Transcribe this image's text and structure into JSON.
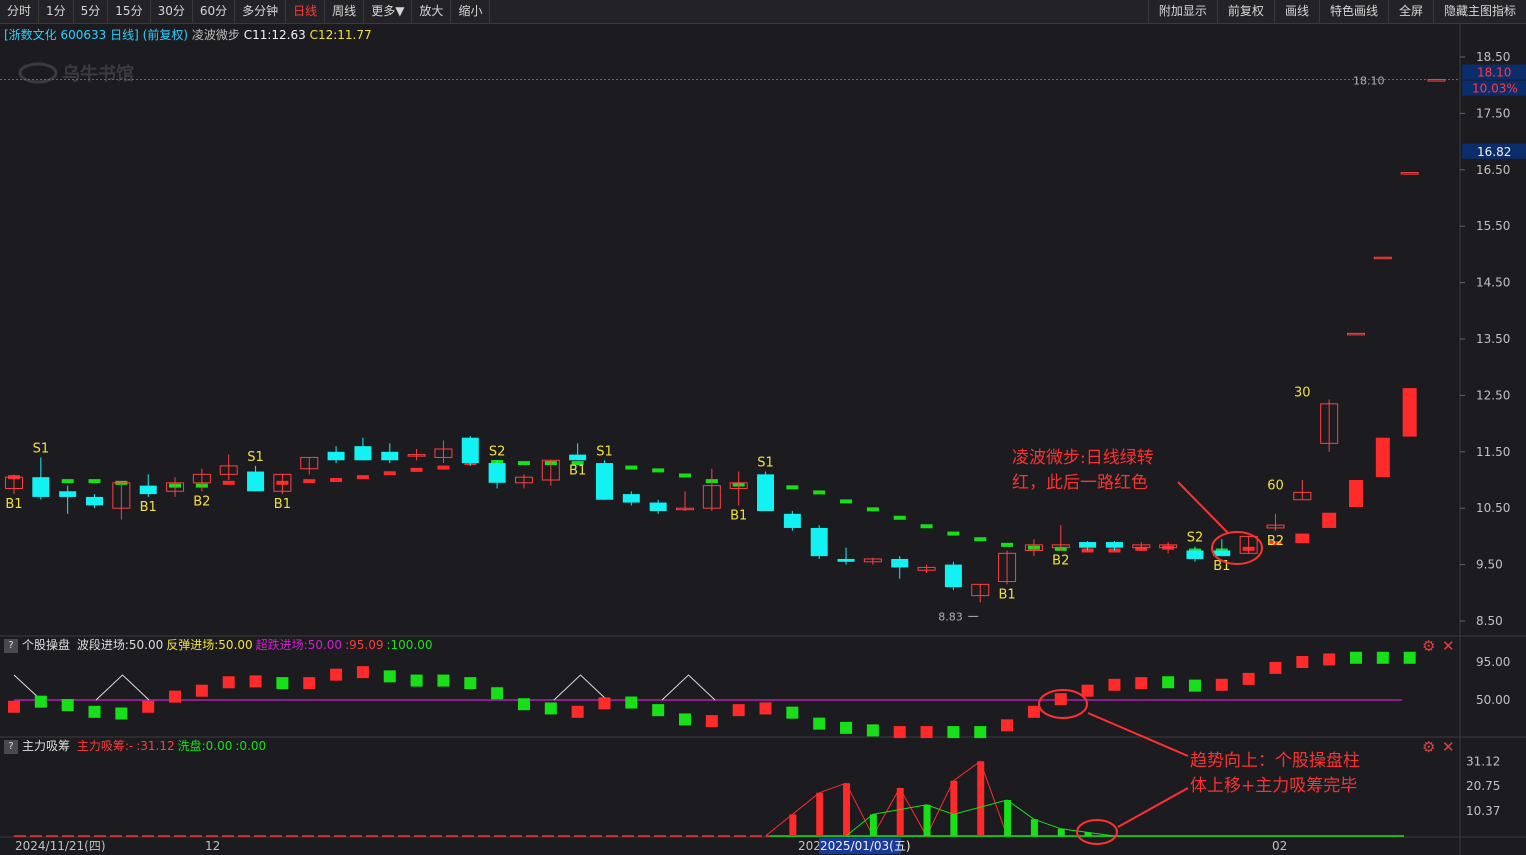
{
  "toolbar": {
    "left": [
      "分时",
      "1分",
      "5分",
      "15分",
      "30分",
      "60分",
      "多分钟",
      "日线",
      "周线",
      "更多▼",
      "放大",
      "缩小"
    ],
    "active": "日线",
    "right": [
      "附加显示",
      "前复权",
      "画线",
      "特色画线",
      "全屏",
      "隐藏主图指标"
    ]
  },
  "header": {
    "stock": "[浙数文化 600633 日线]",
    "adj": "(前复权)",
    "indicator": "凌波微步",
    "c11": "C11:12.63",
    "c12": "C12:11.77"
  },
  "watermark": "乌牛书馆",
  "colors": {
    "up": "#ff2a2a",
    "down": "#13f2f2",
    "green": "#18e018",
    "yellow": "#f0e040",
    "magenta": "#d020d0",
    "bg": "#1c1c20"
  },
  "price_axis": {
    "ticks": [
      "18.50",
      "17.50",
      "16.50",
      "15.50",
      "14.50",
      "13.50",
      "12.50",
      "11.50",
      "10.50",
      "9.50",
      "8.50"
    ],
    "current_price": "18.10",
    "current_pct": "10.03%",
    "cursor_price": "16.82",
    "line_label": "18.10",
    "low_label": "8.83"
  },
  "annotations": {
    "main_line1": "凌波微步:日线绿转",
    "main_line2": "红，此后一路红色",
    "bottom_line1": "趋势向上：个股操盘柱",
    "bottom_line2": "体上移+主力吸筹完毕"
  },
  "signals": {
    "bubble_labels": [
      "60",
      "30"
    ]
  },
  "pane2": {
    "name": "个股操盘",
    "items": [
      {
        "text": "波段进场:50.00",
        "color": "#dddddd"
      },
      {
        "text": "反弹进场:50.00",
        "color": "#f0e040"
      },
      {
        "text": "超跌进场:50.00",
        "color": "#d020d0"
      },
      {
        "text": ":95.09",
        "color": "#ff3b3b"
      },
      {
        "text": ":100.00",
        "color": "#18e018"
      }
    ],
    "ticks": [
      "95.00",
      "50.00"
    ]
  },
  "pane3": {
    "name": "主力吸筹",
    "items": [
      {
        "text": "主力吸筹:-",
        "color": "#ff3b3b"
      },
      {
        "text": ":31.12",
        "color": "#ff3b3b"
      },
      {
        "text": "洗盘:0.00",
        "color": "#18e018"
      },
      {
        "text": ":0.00",
        "color": "#18e018"
      }
    ],
    "ticks": [
      "31.12",
      "20.75",
      "10.37"
    ]
  },
  "date_axis": {
    "labels": [
      "2024/11/21(四)",
      "12",
      "202",
      "2025/01/03(五)",
      "02"
    ]
  },
  "chart_data": {
    "type": "candlestick",
    "title": "",
    "ylim": [
      8.3,
      18.8
    ],
    "candles": [
      {
        "o": 10.85,
        "h": 11.1,
        "l": 10.75,
        "c": 11.05,
        "label": "B1",
        "lp": "below"
      },
      {
        "o": 11.05,
        "h": 11.4,
        "l": 10.65,
        "c": 10.7,
        "label": "S1",
        "lp": "above"
      },
      {
        "o": 10.8,
        "h": 10.9,
        "l": 10.4,
        "c": 10.7
      },
      {
        "o": 10.7,
        "h": 10.75,
        "l": 10.5,
        "c": 10.55
      },
      {
        "o": 10.5,
        "h": 10.95,
        "l": 10.3,
        "c": 10.95
      },
      {
        "o": 10.9,
        "h": 11.1,
        "l": 10.7,
        "c": 10.75,
        "label": "B1",
        "lp": "below"
      },
      {
        "o": 10.8,
        "h": 11.05,
        "l": 10.7,
        "c": 10.95
      },
      {
        "o": 10.95,
        "h": 11.2,
        "l": 10.8,
        "c": 11.1,
        "label": "B2",
        "lp": "below"
      },
      {
        "o": 11.1,
        "h": 11.45,
        "l": 11.0,
        "c": 11.25
      },
      {
        "o": 11.15,
        "h": 11.25,
        "l": 10.8,
        "c": 10.8,
        "label": "S1",
        "lp": "above"
      },
      {
        "o": 10.8,
        "h": 11.1,
        "l": 10.75,
        "c": 11.1,
        "label": "B1",
        "lp": "below"
      },
      {
        "o": 11.2,
        "h": 11.4,
        "l": 11.1,
        "c": 11.4
      },
      {
        "o": 11.5,
        "h": 11.6,
        "l": 11.3,
        "c": 11.35
      },
      {
        "o": 11.6,
        "h": 11.75,
        "l": 11.35,
        "c": 11.35
      },
      {
        "o": 11.5,
        "h": 11.65,
        "l": 11.3,
        "c": 11.35
      },
      {
        "o": 11.45,
        "h": 11.55,
        "l": 11.35,
        "c": 11.45
      },
      {
        "o": 11.4,
        "h": 11.7,
        "l": 11.3,
        "c": 11.55
      },
      {
        "o": 11.75,
        "h": 11.78,
        "l": 11.25,
        "c": 11.3
      },
      {
        "o": 11.3,
        "h": 11.35,
        "l": 10.85,
        "c": 10.95,
        "label": "S2",
        "lp": "above"
      },
      {
        "o": 10.95,
        "h": 11.1,
        "l": 10.85,
        "c": 11.05
      },
      {
        "o": 11.0,
        "h": 11.35,
        "l": 10.9,
        "c": 11.35
      },
      {
        "o": 11.45,
        "h": 11.65,
        "l": 11.35,
        "c": 11.35,
        "label": "B1",
        "lp": "below"
      },
      {
        "o": 11.3,
        "h": 11.35,
        "l": 10.65,
        "c": 10.65,
        "label": "S1",
        "lp": "above"
      },
      {
        "o": 10.75,
        "h": 10.8,
        "l": 10.55,
        "c": 10.6
      },
      {
        "o": 10.6,
        "h": 10.65,
        "l": 10.4,
        "c": 10.45
      },
      {
        "o": 10.5,
        "h": 10.8,
        "l": 10.45,
        "c": 10.5
      },
      {
        "o": 10.5,
        "h": 11.2,
        "l": 10.45,
        "c": 10.9
      },
      {
        "o": 10.85,
        "h": 11.15,
        "l": 10.55,
        "c": 10.95,
        "label": "B1",
        "lp": "below"
      },
      {
        "o": 11.1,
        "h": 11.15,
        "l": 10.45,
        "c": 10.45,
        "label": "S1",
        "lp": "above"
      },
      {
        "o": 10.4,
        "h": 10.45,
        "l": 10.1,
        "c": 10.15
      },
      {
        "o": 10.15,
        "h": 10.2,
        "l": 9.6,
        "c": 9.65
      },
      {
        "o": 9.6,
        "h": 9.8,
        "l": 9.5,
        "c": 9.55
      },
      {
        "o": 9.55,
        "h": 9.62,
        "l": 9.5,
        "c": 9.6
      },
      {
        "o": 9.6,
        "h": 9.65,
        "l": 9.25,
        "c": 9.45
      },
      {
        "o": 9.4,
        "h": 9.5,
        "l": 9.35,
        "c": 9.45
      },
      {
        "o": 9.5,
        "h": 9.55,
        "l": 9.05,
        "c": 9.1
      },
      {
        "o": 8.95,
        "h": 9.15,
        "l": 8.83,
        "c": 9.15
      },
      {
        "o": 9.2,
        "h": 9.75,
        "l": 9.15,
        "c": 9.7,
        "label": "B1",
        "lp": "below"
      },
      {
        "o": 9.75,
        "h": 9.95,
        "l": 9.65,
        "c": 9.85
      },
      {
        "o": 9.8,
        "h": 10.2,
        "l": 9.75,
        "c": 9.85,
        "label": "B2",
        "lp": "below"
      },
      {
        "o": 9.9,
        "h": 9.92,
        "l": 9.75,
        "c": 9.8
      },
      {
        "o": 9.9,
        "h": 9.92,
        "l": 9.75,
        "c": 9.8
      },
      {
        "o": 9.8,
        "h": 9.9,
        "l": 9.75,
        "c": 9.85
      },
      {
        "o": 9.8,
        "h": 9.9,
        "l": 9.7,
        "c": 9.85
      },
      {
        "o": 9.75,
        "h": 9.82,
        "l": 9.55,
        "c": 9.6,
        "label": "S2",
        "lp": "above"
      },
      {
        "o": 9.75,
        "h": 9.95,
        "l": 9.65,
        "c": 9.65,
        "label": "B1",
        "lp": "below"
      },
      {
        "o": 9.7,
        "h": 10.0,
        "l": 9.7,
        "c": 10.0
      },
      {
        "o": 10.15,
        "h": 10.4,
        "l": 10.1,
        "c": 10.2,
        "label": "B2",
        "lp": "below"
      },
      {
        "o": 10.65,
        "h": 11.0,
        "l": 10.65,
        "c": 10.78
      },
      {
        "o": 11.65,
        "h": 12.43,
        "l": 11.5,
        "c": 12.35
      },
      {
        "o": 13.6,
        "h": 13.6,
        "l": 13.6,
        "c": 13.6
      },
      {
        "o": 14.95,
        "h": 14.95,
        "l": 14.95,
        "c": 14.95
      },
      {
        "o": 16.45,
        "h": 16.45,
        "l": 16.45,
        "c": 16.45
      },
      {
        "o": 18.1,
        "h": 18.1,
        "l": 18.1,
        "c": 18.1
      }
    ],
    "lbwb": [
      {
        "v": 11.05,
        "c": "r"
      },
      {
        "v": 10.95,
        "c": "g"
      },
      {
        "v": 10.98,
        "c": "g"
      },
      {
        "v": 10.98,
        "c": "g"
      },
      {
        "v": 10.95,
        "c": "g"
      },
      {
        "v": 10.85,
        "c": "g"
      },
      {
        "v": 10.9,
        "c": "g"
      },
      {
        "v": 10.9,
        "c": "g"
      },
      {
        "v": 10.95,
        "c": "r"
      },
      {
        "v": 10.95,
        "c": "r"
      },
      {
        "v": 10.95,
        "c": "r"
      },
      {
        "v": 10.98,
        "c": "r"
      },
      {
        "v": 11.0,
        "c": "r"
      },
      {
        "v": 11.05,
        "c": "r"
      },
      {
        "v": 11.12,
        "c": "r"
      },
      {
        "v": 11.18,
        "c": "r"
      },
      {
        "v": 11.22,
        "c": "r"
      },
      {
        "v": 11.3,
        "c": "r"
      },
      {
        "v": 11.32,
        "c": "g"
      },
      {
        "v": 11.3,
        "c": "g"
      },
      {
        "v": 11.3,
        "c": "g"
      },
      {
        "v": 11.3,
        "c": "g"
      },
      {
        "v": 11.25,
        "c": "g"
      },
      {
        "v": 11.22,
        "c": "g"
      },
      {
        "v": 11.17,
        "c": "g"
      },
      {
        "v": 11.08,
        "c": "g"
      },
      {
        "v": 10.98,
        "c": "g"
      },
      {
        "v": 10.92,
        "c": "g"
      },
      {
        "v": 10.9,
        "c": "g"
      },
      {
        "v": 10.87,
        "c": "g"
      },
      {
        "v": 10.78,
        "c": "g"
      },
      {
        "v": 10.62,
        "c": "g"
      },
      {
        "v": 10.48,
        "c": "g"
      },
      {
        "v": 10.33,
        "c": "g"
      },
      {
        "v": 10.18,
        "c": "g"
      },
      {
        "v": 10.05,
        "c": "g"
      },
      {
        "v": 9.95,
        "c": "g"
      },
      {
        "v": 9.85,
        "c": "g"
      },
      {
        "v": 9.8,
        "c": "g"
      },
      {
        "v": 9.78,
        "c": "g"
      },
      {
        "v": 9.75,
        "c": "r"
      },
      {
        "v": 9.75,
        "c": "r"
      },
      {
        "v": 9.78,
        "c": "r"
      },
      {
        "v": 9.8,
        "c": "r"
      },
      {
        "v": 9.75,
        "c": "g"
      },
      {
        "v": 9.75,
        "c": "g"
      },
      {
        "v": 9.78,
        "c": "r"
      },
      {
        "v": 9.88,
        "c": "r"
      },
      {
        "v": 9.95,
        "c": "r"
      }
    ],
    "red_bars": [
      {
        "i": 48,
        "o": 9.88,
        "c": 10.05
      },
      {
        "i": 49,
        "o": 10.15,
        "c": 10.42
      },
      {
        "i": 50,
        "o": 10.52,
        "c": 11.0
      },
      {
        "i": 51,
        "o": 11.05,
        "c": 11.75
      },
      {
        "i": 52,
        "o": 11.77,
        "c": 12.63
      }
    ],
    "caozuo": [
      {
        "v": 42,
        "c": "r"
      },
      {
        "v": 48,
        "c": "g"
      },
      {
        "v": 44,
        "c": "g"
      },
      {
        "v": 36,
        "c": "g"
      },
      {
        "v": 34,
        "c": "g"
      },
      {
        "v": 42,
        "c": "r"
      },
      {
        "v": 54,
        "c": "r"
      },
      {
        "v": 61,
        "c": "r"
      },
      {
        "v": 71,
        "c": "r"
      },
      {
        "v": 72,
        "c": "r"
      },
      {
        "v": 70,
        "c": "g"
      },
      {
        "v": 70,
        "c": "r"
      },
      {
        "v": 80,
        "c": "r"
      },
      {
        "v": 83,
        "c": "r"
      },
      {
        "v": 78,
        "c": "g"
      },
      {
        "v": 73,
        "c": "g"
      },
      {
        "v": 73,
        "c": "g"
      },
      {
        "v": 70,
        "c": "g"
      },
      {
        "v": 58,
        "c": "g"
      },
      {
        "v": 45,
        "c": "g"
      },
      {
        "v": 40,
        "c": "g"
      },
      {
        "v": 36,
        "c": "r"
      },
      {
        "v": 46,
        "c": "r"
      },
      {
        "v": 47,
        "c": "g"
      },
      {
        "v": 38,
        "c": "g"
      },
      {
        "v": 27,
        "c": "g"
      },
      {
        "v": 25,
        "c": "r"
      },
      {
        "v": 38,
        "c": "r"
      },
      {
        "v": 40,
        "c": "r"
      },
      {
        "v": 35,
        "c": "g"
      },
      {
        "v": 22,
        "c": "g"
      },
      {
        "v": 17,
        "c": "g"
      },
      {
        "v": 14,
        "c": "g"
      },
      {
        "v": 12,
        "c": "r"
      },
      {
        "v": 12,
        "c": "r"
      },
      {
        "v": 12,
        "c": "g"
      },
      {
        "v": 12,
        "c": "g"
      },
      {
        "v": 20,
        "c": "r"
      },
      {
        "v": 36,
        "c": "r"
      },
      {
        "v": 51,
        "c": "r"
      },
      {
        "v": 61,
        "c": "r"
      },
      {
        "v": 68,
        "c": "r"
      },
      {
        "v": 70,
        "c": "r"
      },
      {
        "v": 71,
        "c": "g"
      },
      {
        "v": 67,
        "c": "g"
      },
      {
        "v": 68,
        "c": "r"
      },
      {
        "v": 75,
        "c": "r"
      },
      {
        "v": 88,
        "c": "r"
      },
      {
        "v": 95,
        "c": "r"
      },
      {
        "v": 98,
        "c": "r"
      },
      {
        "v": 100,
        "c": "g"
      },
      {
        "v": 100,
        "c": "g"
      },
      {
        "v": 100,
        "c": "g"
      }
    ],
    "zhuli": [
      {
        "i": 29,
        "v": 9
      },
      {
        "i": 30,
        "v": 18
      },
      {
        "i": 31,
        "v": 22
      },
      {
        "i": 32,
        "v": 0
      },
      {
        "i": 33,
        "v": 20
      },
      {
        "i": 34,
        "v": 0
      },
      {
        "i": 35,
        "v": 23
      },
      {
        "i": 36,
        "v": 31.12
      },
      {
        "i": 37,
        "v": 0
      }
    ],
    "xipan": [
      {
        "i": 32,
        "v": 9
      },
      {
        "i": 34,
        "v": 13
      },
      {
        "i": 35,
        "v": 9
      },
      {
        "i": 37,
        "v": 15
      },
      {
        "i": 38,
        "v": 7
      },
      {
        "i": 39,
        "v": 3
      },
      {
        "i": 40,
        "v": 1.5
      }
    ],
    "ymax3": 35
  }
}
